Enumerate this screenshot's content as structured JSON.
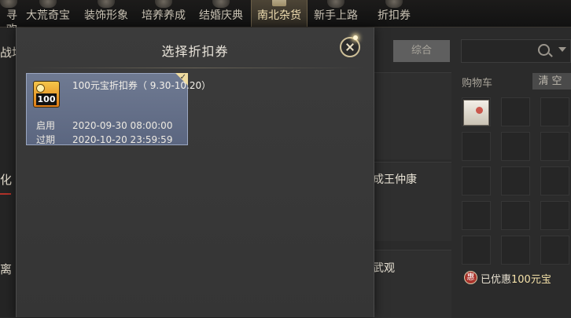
{
  "nav": {
    "tabs": [
      {
        "label": "寻欢",
        "active": false
      },
      {
        "label": "大荒奇宝",
        "active": false
      },
      {
        "label": "装饰形象",
        "active": false
      },
      {
        "label": "培养养成",
        "active": false
      },
      {
        "label": "结婚庆典",
        "active": false
      },
      {
        "label": "南北杂货",
        "active": true
      },
      {
        "label": "新手上路",
        "active": false
      },
      {
        "label": "折扣券",
        "active": false
      }
    ]
  },
  "background": {
    "left_texts": [
      "战场",
      "化",
      "离"
    ],
    "row_names": [
      "成王仲康",
      "武观"
    ],
    "zonghe_label": "综合",
    "cart_title": "购物车",
    "clear_label": "清空",
    "cart_item_icon": "mahjong-tile-icon",
    "discount_badge": "惠",
    "discount_prefix": "已优惠",
    "discount_amount": "100元宝"
  },
  "modal": {
    "title": "选择折扣券",
    "coupon": {
      "icon_text": "100",
      "name": "100元宝折扣券（ 9.30-10.20）",
      "start_label": "启用",
      "start_value": "2020-09-30 08:00:00",
      "end_label": "过期",
      "end_value": "2020-10-20 23:59:59",
      "selected": true
    }
  },
  "colors": {
    "accent_gold": "#f0dca0",
    "coupon_card": "#6f7a92",
    "active_tab_text": "#f1dfb2",
    "discount_red": "#a8332b"
  }
}
